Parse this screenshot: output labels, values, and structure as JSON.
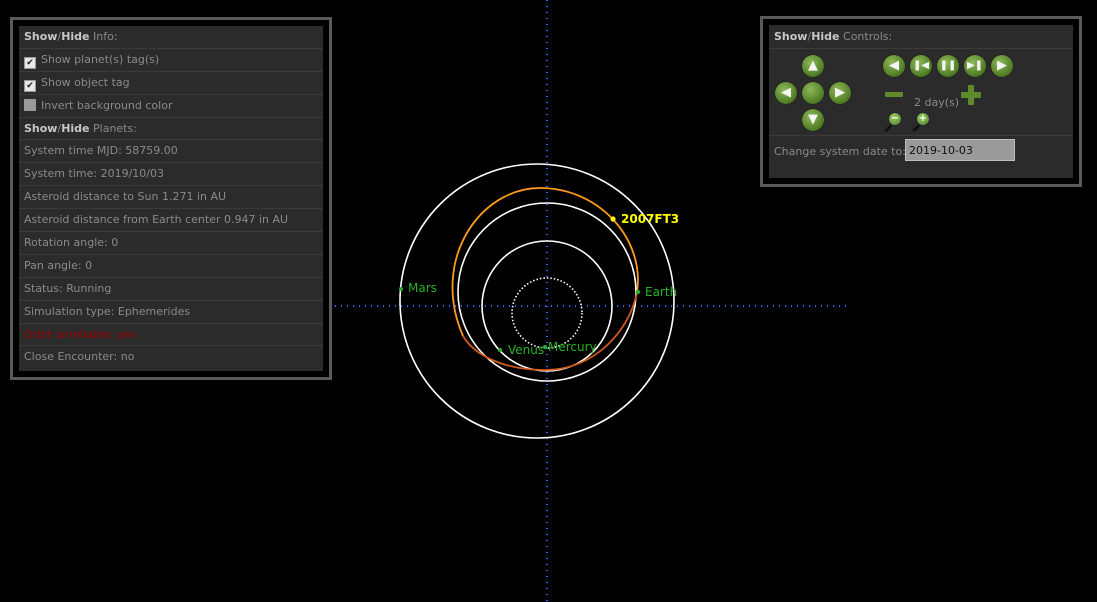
{
  "info_panel": {
    "header_show": "Show",
    "header_hide": "Hide",
    "header_suffix": " Info:",
    "show_planet_tags": "Show planet(s) tag(s)",
    "show_object_tag": "Show object tag",
    "invert_bg": "Invert background color",
    "planets_header_show": "Show",
    "planets_header_hide": "Hide",
    "planets_header_suffix": " Planets:",
    "system_time_mjd": "System time MJD: 58759.00",
    "system_time": "System time: 2019/10/03",
    "asteroid_dist_sun": "Asteroid distance to Sun 1.271 in AU",
    "asteroid_dist_earth": "Asteroid distance from Earth center 0.947 in AU",
    "rotation_angle": "Rotation angle: 0",
    "pan_angle": "Pan angle: 0",
    "status": "Status: Running",
    "simulation_type": "Simulation type: Ephemerides",
    "orbit_error": "Orbit unreliable: yes",
    "close_encounter": "Close Encounter: no"
  },
  "controls_panel": {
    "header_show": "Show",
    "header_hide": "Hide",
    "header_suffix": " Controls:",
    "step_label": "2 day(s)",
    "date_label": "Change system date to:",
    "date_value": "2019-10-03",
    "icons": {
      "up": "arrow-up-icon",
      "down": "arrow-down-icon",
      "left": "arrow-left-icon",
      "right": "arrow-right-icon",
      "center": "center-icon",
      "rewind": "play-backward-icon",
      "step_back": "step-backward-icon",
      "pause": "pause-icon",
      "step_forward": "step-forward-icon",
      "play": "play-forward-icon",
      "decrease": "minus-icon",
      "increase": "plus-icon",
      "zoom_out": "zoom-out-icon",
      "zoom_in": "zoom-in-icon"
    }
  },
  "orbit_view": {
    "asteroid_label": "2007FT3",
    "planet_labels": {
      "mars": "Mars",
      "earth": "Earth",
      "venus": "Venus",
      "mercury": "Mercury"
    },
    "colors": {
      "planet_label": "#2bb02b",
      "asteroid_label": "#ffff00",
      "orbit": "#ffffff",
      "asteroid_orbit_front": "#ff9a1a",
      "asteroid_orbit_back": "#d2591c",
      "axes": "#2f6bff"
    }
  }
}
